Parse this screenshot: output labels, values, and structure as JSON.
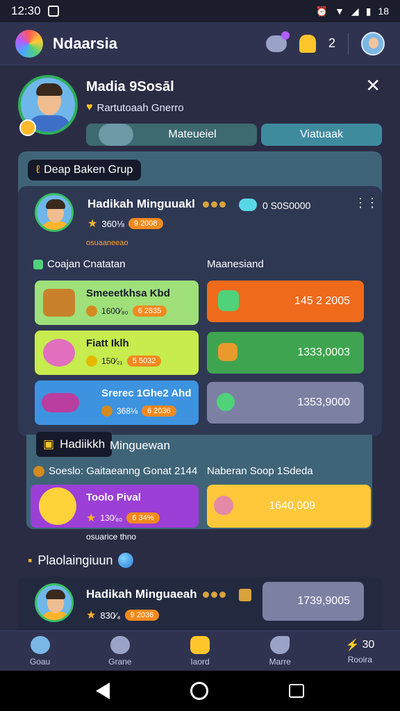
{
  "status_bar": {
    "time": "12:30",
    "battery": "18"
  },
  "app_bar": {
    "title": "Ndaarsia",
    "notification_count": "2"
  },
  "profile": {
    "name": "Madia 9Sosāl",
    "subtitle": "Rartutoaah Gnerro",
    "button_primary": "Mateueiel",
    "button_secondary": "Viatuaak"
  },
  "group": {
    "tag": "Deap Baken Grup",
    "user": {
      "name": "Hadikah Minguuakl",
      "stars": "360⅛",
      "chip": "9 2008",
      "note": "osuaaneeao",
      "balance": "0 S0S0000"
    },
    "left_label": "Coajan Cnatatan",
    "right_label": "Maanesiand",
    "cards_left": [
      {
        "title": "Smeeetkhsa Kbd",
        "meta": "1600⁄₈₀",
        "chip": "6 2835",
        "bg": "#9fe07a"
      },
      {
        "title": "Fiatt Iklh",
        "meta": "150⁄₂₁",
        "chip": "5 5032",
        "bg": "#c6ec4d"
      },
      {
        "title": "Srerec 1Ghe2 Ahd",
        "meta": "368⅛",
        "chip": "6 2036",
        "bg": "#3d93e0"
      }
    ],
    "cards_right": [
      {
        "value": "145 2 2005",
        "bg": "#f06a1c"
      },
      {
        "value": "1333,0003",
        "bg": "#3fa44f"
      },
      {
        "value": "1353,9000",
        "bg": "#7c81a3"
      }
    ]
  },
  "section2": {
    "tag": "Hadiikkh",
    "tag_rest": "Minguewan",
    "sub_left": "Soeslo: Gaitaeanng Gonat 2144",
    "sub_right": "Naberan Soop 1Sdeda",
    "card_left_title": "Toolo Pival",
    "card_left_meta": "130⁄₈₀",
    "card_left_chip": "6 34%",
    "card_right_value": "1640,009",
    "footnote": "osuarice thno"
  },
  "playing": {
    "label": "Plaolaingiuun",
    "user_name": "Hadikah Minguaeah",
    "stars": "830⁄₄",
    "chip": "9 2036",
    "value": "1739,9005"
  },
  "nav": [
    {
      "label": "Goau",
      "icon": "avatar-icon"
    },
    {
      "label": "Grane",
      "icon": "chat-icon"
    },
    {
      "label": "Iaord",
      "icon": "coin-icon"
    },
    {
      "label": "Marre",
      "icon": "message-icon"
    },
    {
      "label": "Rooira",
      "icon": "stats-icon",
      "badge": "30"
    }
  ],
  "colors": {
    "background": "#2a2c44",
    "accent_green": "#2fae5b",
    "accent_orange": "#f28a1e",
    "accent_purple": "#9b3fd6",
    "accent_yellow": "#ffc73a"
  }
}
